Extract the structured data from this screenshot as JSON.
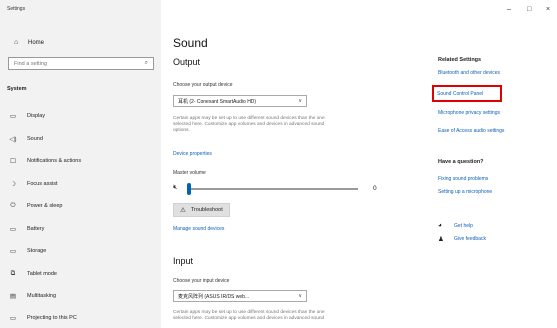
{
  "app": {
    "title": "Settings"
  },
  "window_controls": {
    "minimize": "–",
    "maximize": "□",
    "close": "×"
  },
  "sidebar": {
    "home": {
      "label": "Home",
      "icon": "home-icon"
    },
    "search": {
      "placeholder": "Find a setting",
      "icon": "search-icon"
    },
    "section": "System",
    "items": [
      {
        "label": "Display",
        "icon": "display-icon",
        "glyph": "▭"
      },
      {
        "label": "Sound",
        "icon": "sound-icon",
        "glyph": "◁)"
      },
      {
        "label": "Notifications & actions",
        "icon": "notifications-icon",
        "glyph": "☐"
      },
      {
        "label": "Focus assist",
        "icon": "focus-assist-icon",
        "glyph": "☽"
      },
      {
        "label": "Power & sleep",
        "icon": "power-icon",
        "glyph": "⏻"
      },
      {
        "label": "Battery",
        "icon": "battery-icon",
        "glyph": "▭"
      },
      {
        "label": "Storage",
        "icon": "storage-icon",
        "glyph": "▭"
      },
      {
        "label": "Tablet mode",
        "icon": "tablet-mode-icon",
        "glyph": "⧉"
      },
      {
        "label": "Multitasking",
        "icon": "multitasking-icon",
        "glyph": "▤"
      },
      {
        "label": "Projecting to this PC",
        "icon": "projecting-icon",
        "glyph": "▭"
      }
    ]
  },
  "main": {
    "title": "Sound",
    "output": {
      "heading": "Output",
      "device_label": "Choose your output device",
      "device_value": "耳机 (2- Conexant SmartAudio HD)",
      "description": "Certain apps may be set up to use different sound devices than the one\nselected here. Customize app volumes and devices in advanced sound\noptions.",
      "device_properties": "Device properties",
      "master_volume_label": "Master volume",
      "volume_value": "0",
      "volume_level": 0,
      "troubleshoot": "Troubleshoot",
      "manage_devices": "Manage sound devices"
    },
    "input": {
      "heading": "Input",
      "device_label": "Choose your input device",
      "device_value": "麦克风阵列 (ASUS IR/DS web...",
      "description": "Certain apps may be set up to use different sound devices than the one\nselected here. Customize app volumes and devices in advanced sound"
    }
  },
  "related": {
    "title": "Related Settings",
    "links": [
      "Bluetooth and other devices",
      "Sound Control Panel",
      "Microphone privacy settings",
      "Ease of Access audio settings"
    ],
    "question_title": "Have a question?",
    "question_links": [
      "Fixing sound problems",
      "Setting up a microphone"
    ],
    "get_help": "Get help",
    "give_feedback": "Give feedback",
    "highlight_color": "#e00000"
  },
  "colors": {
    "accent": "#0063b1",
    "link": "#1060b8",
    "sidebar_bg": "#f2f2f2"
  }
}
